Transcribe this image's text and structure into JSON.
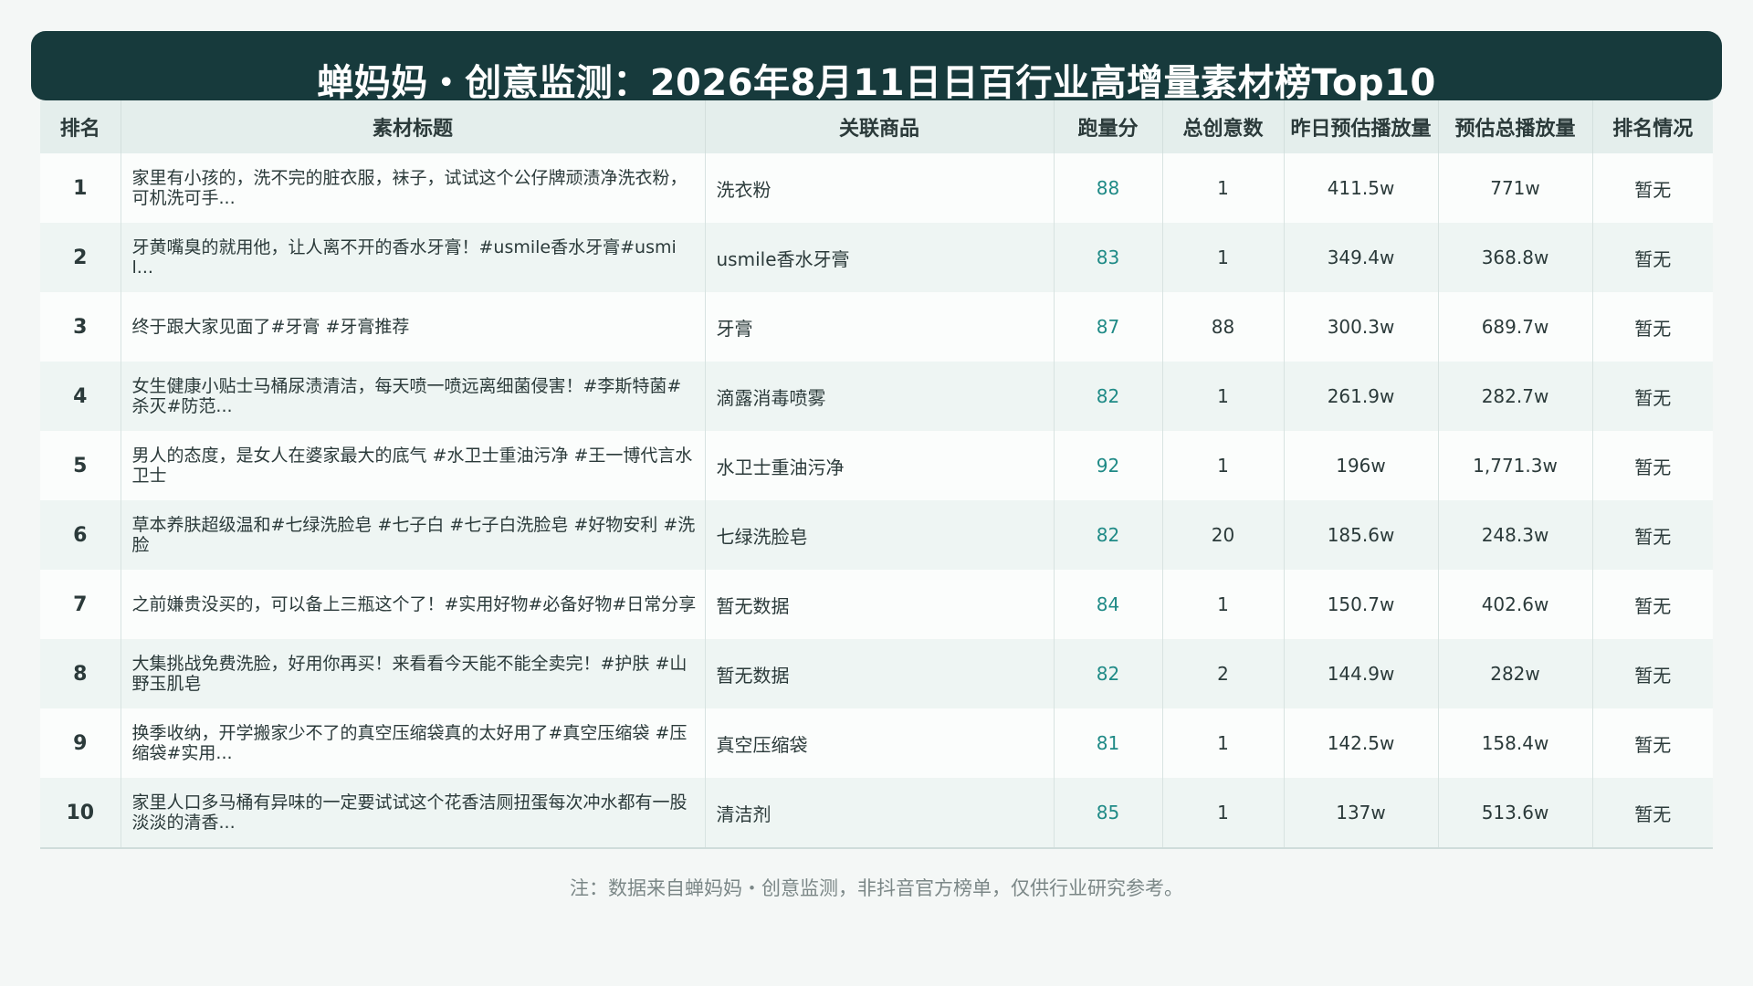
{
  "title": "蝉妈妈・创意监测：2026年8月11日日百行业高增量素材榜Top10",
  "columns": {
    "rank": "排名",
    "title": "素材标题",
    "product": "关联商品",
    "score": "跑量分",
    "creatives": "总创意数",
    "yesterday_plays": "昨日预估播放量",
    "total_plays": "预估总播放量",
    "ranking_status": "排名情况"
  },
  "rows": [
    {
      "rank": "1",
      "title": "家里有小孩的，洗不完的脏衣服，袜子，试试这个公仔牌顽渍净洗衣粉，可机洗可手...",
      "product": "洗衣粉",
      "score": "88",
      "creatives": "1",
      "yesterday_plays": "411.5w",
      "total_plays": "771w",
      "ranking_status": "暂无"
    },
    {
      "rank": "2",
      "title": "牙黄嘴臭的就用他，让人离不开的香水牙膏！#usmile香水牙膏#usmil...",
      "product": "usmile香水牙膏",
      "score": "83",
      "creatives": "1",
      "yesterday_plays": "349.4w",
      "total_plays": "368.8w",
      "ranking_status": "暂无"
    },
    {
      "rank": "3",
      "title": "终于跟大家见面了#牙膏 #牙膏推荐",
      "product": "牙膏",
      "score": "87",
      "creatives": "88",
      "yesterday_plays": "300.3w",
      "total_plays": "689.7w",
      "ranking_status": "暂无"
    },
    {
      "rank": "4",
      "title": "女生健康小贴士马桶尿渍清洁，每天喷一喷远离细菌侵害！#李斯特菌#杀灭#防范...",
      "product": "滴露消毒喷雾",
      "score": "82",
      "creatives": "1",
      "yesterday_plays": "261.9w",
      "total_plays": "282.7w",
      "ranking_status": "暂无"
    },
    {
      "rank": "5",
      "title": "男人的态度，是女人在婆家最大的底气 #水卫士重油污净 #王一博代言水卫士",
      "product": "水卫士重油污净",
      "score": "92",
      "creatives": "1",
      "yesterday_plays": "196w",
      "total_plays": "1,771.3w",
      "ranking_status": "暂无"
    },
    {
      "rank": "6",
      "title": "草本养肤超级温和#七绿洗脸皂 #七子白 #七子白洗脸皂 #好物安利 #洗脸",
      "product": "七绿洗脸皂",
      "score": "82",
      "creatives": "20",
      "yesterday_plays": "185.6w",
      "total_plays": "248.3w",
      "ranking_status": "暂无"
    },
    {
      "rank": "7",
      "title": "之前嫌贵没买的，可以备上三瓶这个了！#实用好物#必备好物#日常分享",
      "product": "暂无数据",
      "score": "84",
      "creatives": "1",
      "yesterday_plays": "150.7w",
      "total_plays": "402.6w",
      "ranking_status": "暂无"
    },
    {
      "rank": "8",
      "title": "大集挑战免费洗脸，好用你再买！来看看今天能不能全卖完！#护肤 #山野玉肌皂",
      "product": "暂无数据",
      "score": "82",
      "creatives": "2",
      "yesterday_plays": "144.9w",
      "total_plays": "282w",
      "ranking_status": "暂无"
    },
    {
      "rank": "9",
      "title": "换季收纳，开学搬家少不了的真空压缩袋真的太好用了#真空压缩袋 #压缩袋#实用...",
      "product": "真空压缩袋",
      "score": "81",
      "creatives": "1",
      "yesterday_plays": "142.5w",
      "total_plays": "158.4w",
      "ranking_status": "暂无"
    },
    {
      "rank": "10",
      "title": "家里人口多马桶有异味的一定要试试这个花香洁厕扭蛋每次冲水都有一股淡淡的清香...",
      "product": "清洁剂",
      "score": "85",
      "creatives": "1",
      "yesterday_plays": "137w",
      "total_plays": "513.6w",
      "ranking_status": "暂无"
    }
  ],
  "footnote": "注：数据来自蝉妈妈・创意监测，非抖音官方榜单，仅供行业研究参考。",
  "colors": {
    "title_bg": "#173a3c",
    "header_bg": "#e4eeec",
    "score_text": "#1f8a86",
    "page_bg": "#f4f7f6"
  }
}
